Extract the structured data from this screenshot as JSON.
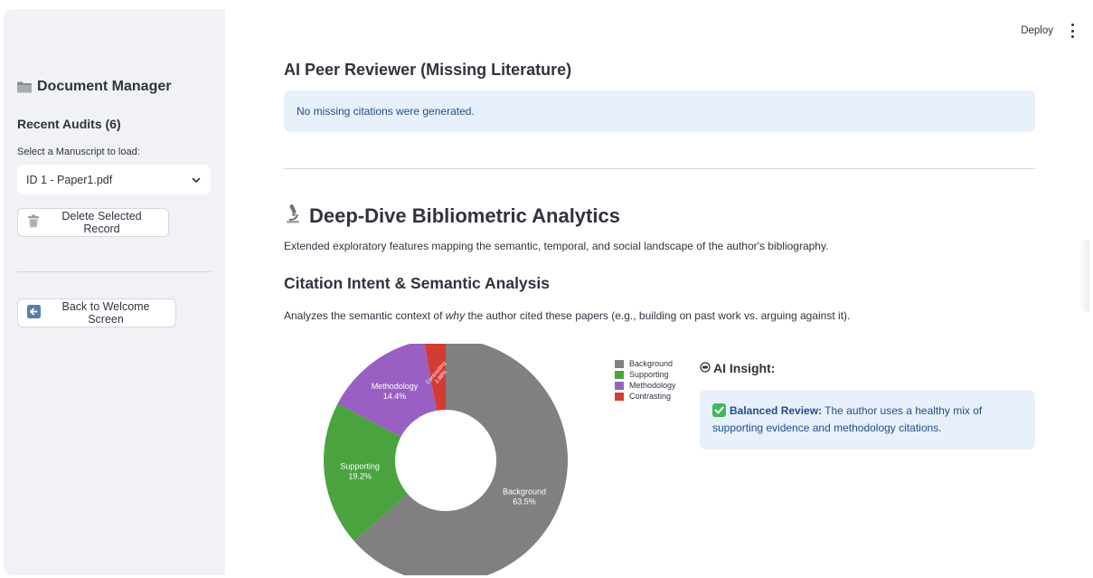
{
  "topbar": {
    "deploy_label": "Deploy"
  },
  "sidebar": {
    "title": "Document Manager",
    "recent_audits": "Recent Audits (6)",
    "select_label": "Select a Manuscript to load:",
    "selected_value": "ID 1 - Paper1.pdf",
    "delete_button": "Delete Selected Record",
    "back_button": "Back to Welcome Screen"
  },
  "main": {
    "peer_reviewer_title": "AI Peer Reviewer (Missing Literature)",
    "peer_reviewer_info": "No missing citations were generated.",
    "analytics_title": "Deep-Dive Bibliometric Analytics",
    "analytics_desc": "Extended exploratory features mapping the semantic, temporal, and social landscape of the author's bibliography.",
    "intent_title": "Citation Intent & Semantic Analysis",
    "intent_desc_pre": "Analyzes the semantic context of ",
    "intent_desc_em": "why",
    "intent_desc_post": " the author cited these papers (e.g., building on past work vs. arguing against it).",
    "insight_title": "AI Insight:",
    "insight_bold": "Balanced Review:",
    "insight_text": " The author uses a healthy mix of supporting evidence and methodology citations."
  },
  "chart_data": {
    "type": "pie",
    "donut": true,
    "categories": [
      "Background",
      "Supporting",
      "Methodology",
      "Contrasting"
    ],
    "values": [
      63.5,
      19.2,
      14.4,
      2.88
    ],
    "labels": [
      "63.5%",
      "19.2%",
      "14.4%",
      "2.88%"
    ],
    "colors": [
      "#808080",
      "#4aa33f",
      "#9a5fc2",
      "#d43c33"
    ],
    "legend_position": "right"
  }
}
